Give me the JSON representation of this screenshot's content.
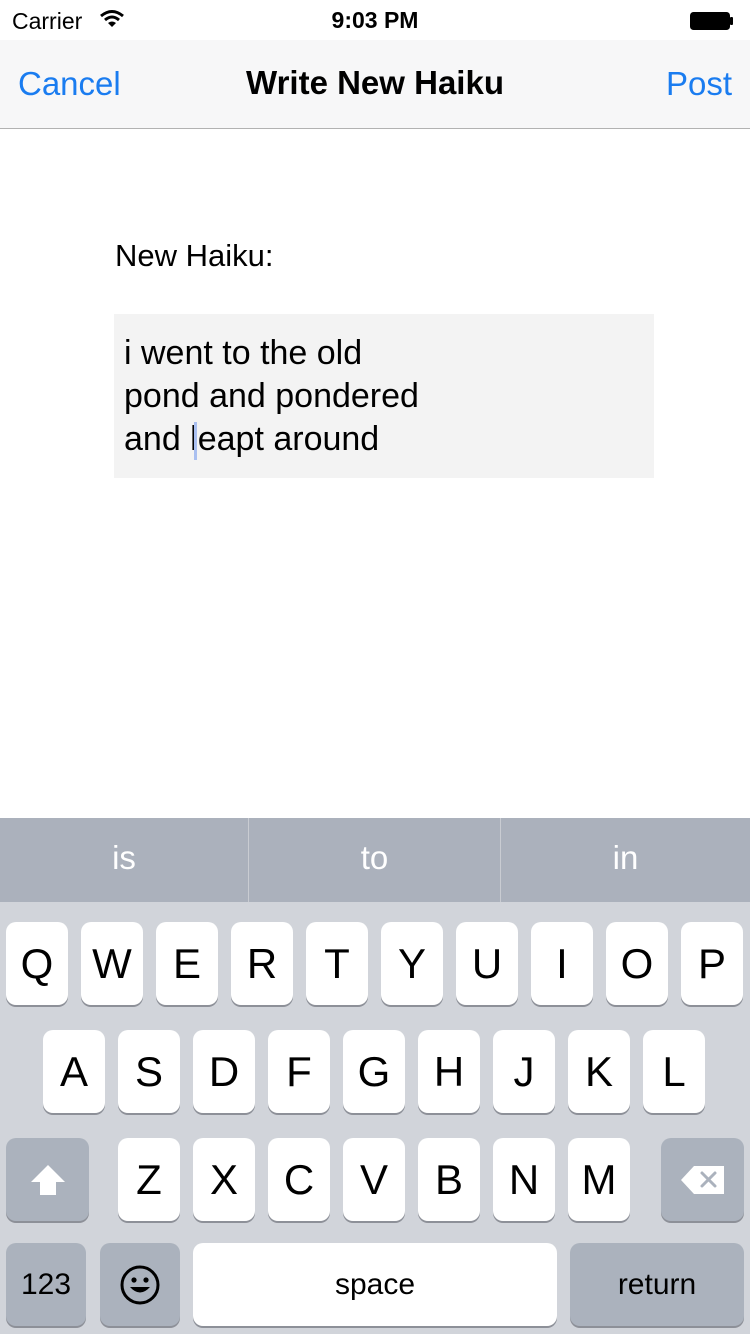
{
  "status_bar": {
    "carrier": "Carrier",
    "time": "9:03 PM"
  },
  "nav": {
    "cancel_label": "Cancel",
    "title": "Write New Haiku",
    "post_label": "Post"
  },
  "form": {
    "label": "New Haiku:",
    "haiku_lines": [
      "i went to the old",
      "pond and pondered",
      "and leapt around"
    ]
  },
  "keyboard": {
    "suggestions": [
      "is",
      "to",
      "in"
    ],
    "row1": [
      "Q",
      "W",
      "E",
      "R",
      "T",
      "Y",
      "U",
      "I",
      "O",
      "P"
    ],
    "row2": [
      "A",
      "S",
      "D",
      "F",
      "G",
      "H",
      "J",
      "K",
      "L"
    ],
    "row3": [
      "Z",
      "X",
      "C",
      "V",
      "B",
      "N",
      "M"
    ],
    "numbers_label": "123",
    "space_label": "space",
    "return_label": "return",
    "shift_icon": "shift-arrow-icon",
    "delete_icon": "backspace-icon",
    "emoji_icon": "emoji-smiley-icon"
  },
  "colors": {
    "accent": "#1a7cf0",
    "keyboard_bg": "#d1d4da",
    "suggest_bg": "#abb1bc"
  }
}
